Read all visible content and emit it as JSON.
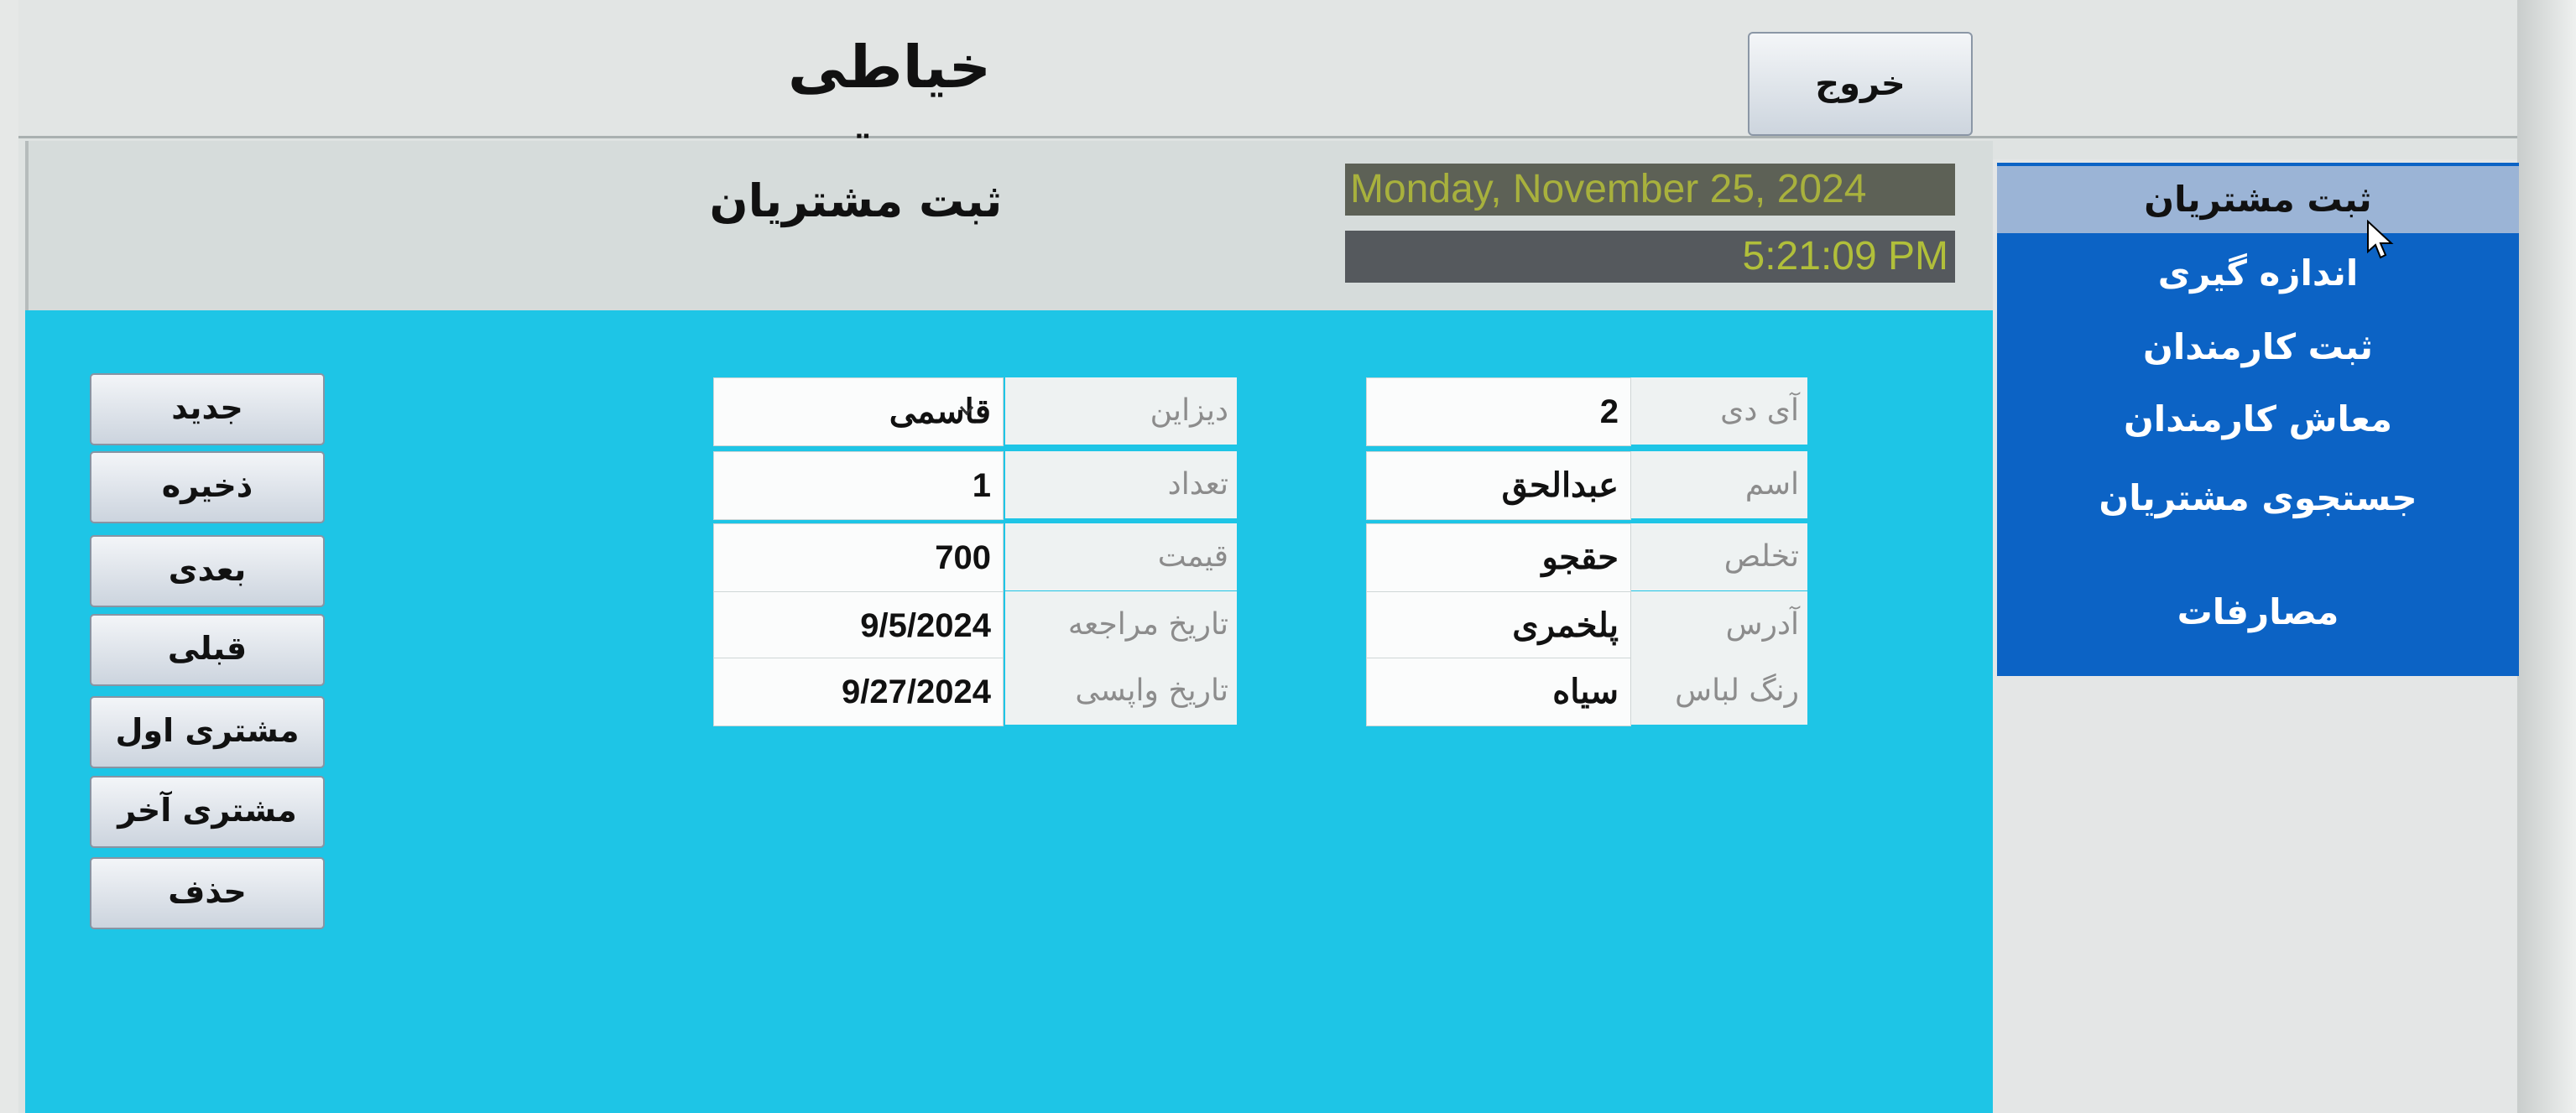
{
  "app": {
    "title": "خیاطی صدیقی",
    "exit_label": "خروج"
  },
  "header": {
    "section_title": "ثبت مشتریان",
    "date": "Monday, November 25, 2024",
    "time": "5:21:09 PM"
  },
  "nav": {
    "items": [
      {
        "label": "ثبت مشتریان"
      },
      {
        "label": "اندازه گیری"
      },
      {
        "label": "ثبت کارمندان"
      },
      {
        "label": "معاش کارمندان"
      },
      {
        "label": "جستجوی مشتریان"
      },
      {
        "label": "مصارفات"
      }
    ]
  },
  "actions": {
    "new": "جدید",
    "save": "ذخیره",
    "next": "بعدی",
    "previous": "قبلی",
    "first": "مشتری اول",
    "last": "مشتری آخر",
    "delete": "حذف"
  },
  "form": {
    "right": [
      {
        "label": "آی دی",
        "value": "2"
      },
      {
        "label": "اسم",
        "value": "عبدالحق"
      },
      {
        "label": "تخلص",
        "value": "حقجو"
      },
      {
        "label": "آدرس",
        "value": "پلخمری"
      },
      {
        "label": "رنگ لباس",
        "value": "سیاه"
      }
    ],
    "left": [
      {
        "label": "دیزاین",
        "value": "قاسمی"
      },
      {
        "label": "تعداد",
        "value": "1"
      },
      {
        "label": "قیمت",
        "value": "700"
      },
      {
        "label": "تاریخ مراجعه",
        "value": "9/5/2024"
      },
      {
        "label": "تاریخ واپسی",
        "value": "9/27/2024"
      }
    ]
  },
  "colors": {
    "form_bg": "#1ec5e6",
    "nav_bg": "#0c63c5",
    "nav_active": "#9bb4d6",
    "clock_text": "#b1bf3a"
  }
}
